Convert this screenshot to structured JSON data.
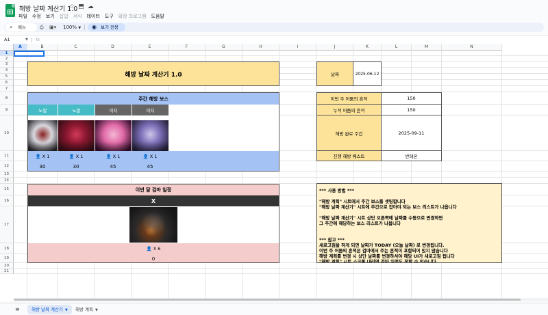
{
  "app": {
    "doc_title": "해방 날짜 계산기 1.0",
    "menu": [
      "파일",
      "수정",
      "보기",
      "삽입",
      "서식",
      "데이터",
      "도구",
      "확장 프로그램",
      "도움말"
    ],
    "menu_muted": [
      false,
      false,
      false,
      true,
      true,
      false,
      false,
      true,
      false
    ],
    "toolbar": {
      "search_label": "메뉴",
      "zoom": "100%",
      "view_only_label": "보기 전용"
    },
    "namebox": "A1",
    "fx": "fx"
  },
  "grid": {
    "columns": [
      "A",
      "B",
      "C",
      "D",
      "E",
      "F",
      "G",
      "H",
      "I",
      "J",
      "K",
      "L",
      "M",
      "N"
    ],
    "rows": [
      "1",
      "2",
      "3",
      "4",
      "5",
      "6",
      "7",
      "8",
      "9",
      "10",
      "11",
      "12",
      "13",
      "14",
      "15",
      "16",
      "17",
      "18",
      "19",
      "20",
      "21"
    ]
  },
  "sheet": {
    "title": "해방 날짜 계산기 1.0",
    "weekly": {
      "header": "주간 해방 보스",
      "difficulties": [
        "노말",
        "노말",
        "이지",
        "이지"
      ],
      "difficulty_kinds": [
        "normal",
        "normal",
        "easy",
        "easy"
      ],
      "counts": [
        "X 1",
        "X 1",
        "X 1",
        "X 1"
      ],
      "points": [
        "30",
        "30",
        "45",
        "45"
      ]
    },
    "monthly": {
      "header": "이번 달 검마 일정",
      "bar": "X",
      "count": "X 6",
      "points": "0"
    },
    "date_label": "날짜",
    "date_value": "2025-06-12",
    "stats": [
      {
        "label": "이번 주 어둠의 흔적",
        "value": "150"
      },
      {
        "label": "누적 어둠의 흔적",
        "value": "150"
      },
      {
        "label": "해방 완료 주간",
        "value": "2025-09-11"
      },
      {
        "label": "진행 해방 퀘스트",
        "value": "반레온"
      }
    ],
    "notes": {
      "lines": [
        "*** 사용 방법 ***",
        "",
        "\"해방 계획\" 시트에서 주간 보스를 셋팅합니다",
        "\"해방 날짜 계산기\" 시트에 주간으로 잡아야 되는 보스 리스트가 나옵니다",
        "",
        "\"해방 날짜 계산기\" 시트 상단 오른쪽에 날짜를 수동으로 변경하면",
        "그 주간에 해당하는 보스 리스트가 나옵니다",
        "",
        "",
        "*** 참고 ***",
        "새로고침을 하게 되면 날짜가 TODAY (오늘 날짜) 로 변경됩니다.",
        "이번 주 어둠의 흔적은 검마에서 주는 흔적이 포함되어 있지 않습니다",
        "해방 계획를 변경 시 상단 날짜를 변경하셔야 해당 UI가 새로고침 됩니다",
        "\"해방 계획\" 시트 스크롤 내리면 검마 일정도 정할 수 있습니다"
      ]
    }
  },
  "tabs": [
    {
      "label": "해방 날짜 계산기",
      "active": true
    },
    {
      "label": "해방 계획",
      "active": false
    }
  ],
  "colors": {
    "sheets_green": "#0f9d58",
    "title_yellow": "#fde39a",
    "weekly_blue": "#a4c2f4",
    "normal_teal": "#46bdc6",
    "easy_gray": "#666666",
    "monthly_pink": "#f4cccc",
    "notes_bg": "#fff2cc",
    "accent_blue": "#1a73e8"
  }
}
